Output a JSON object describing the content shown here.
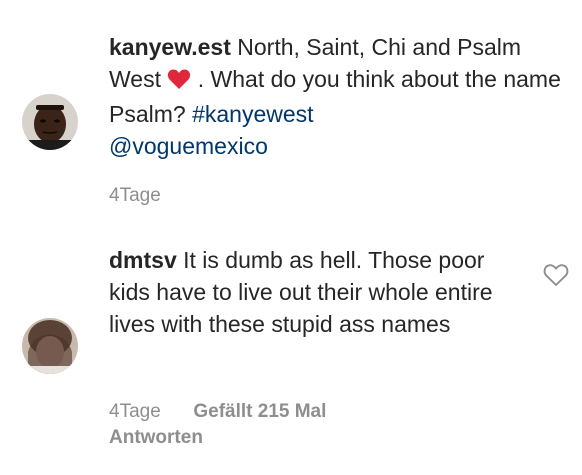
{
  "post": {
    "username": "kanyew.est",
    "caption_part1": "North, Saint, Chi and Psalm West",
    "caption_part2": ". What do you think about the name Psalm?",
    "hashtag": "#kanyewest",
    "mention": "@voguemexico",
    "time": "4Tage",
    "emoji": "red-heart"
  },
  "comment": {
    "username": "dmtsv",
    "text": "It is dumb as hell. Those poor kids have to live out their whole entire lives with these stupid ass names",
    "time": "4Tage",
    "likes": "Gefällt 215 Mal",
    "reply": "Antworten",
    "like_icon": "heart-outline-icon"
  },
  "colors": {
    "text": "#262626",
    "link": "#00376b",
    "meta": "#8e8e8e",
    "heart": "#ed4956"
  }
}
